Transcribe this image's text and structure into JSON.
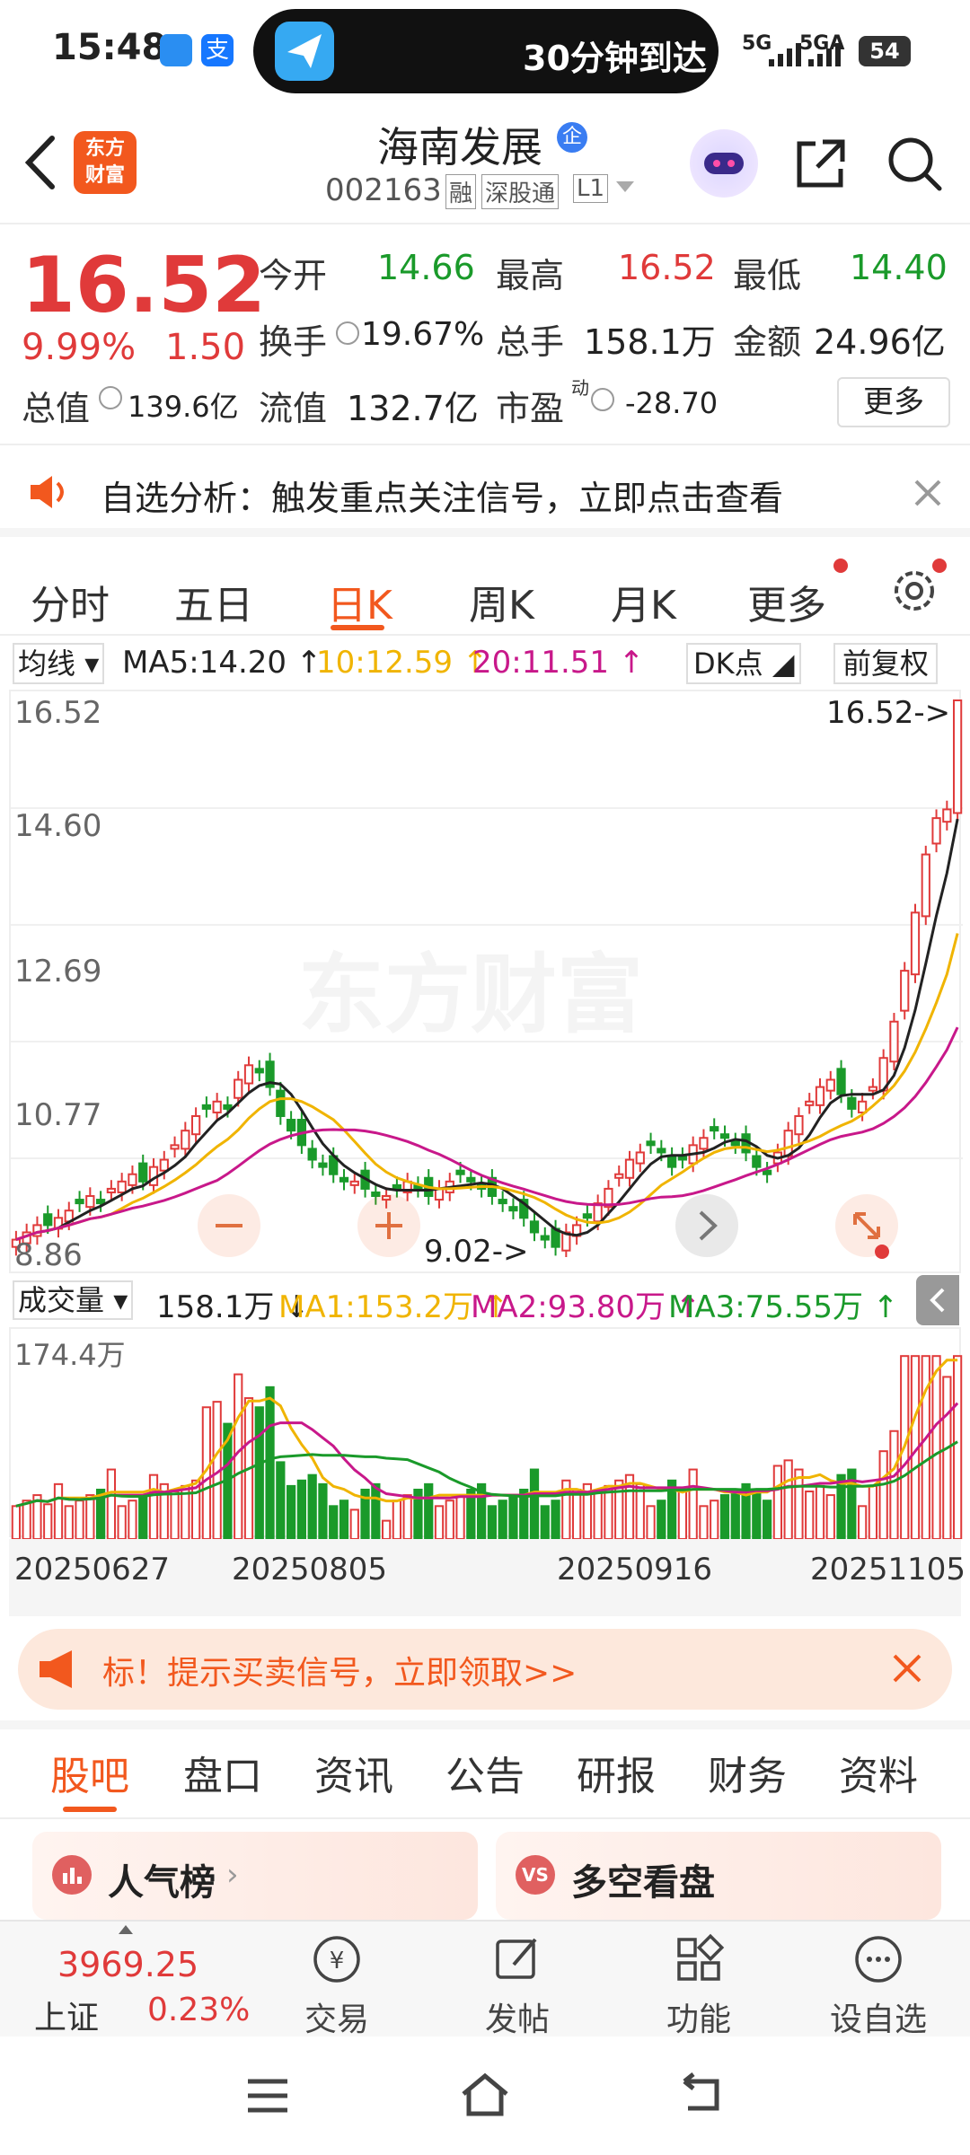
{
  "status": {
    "time": "15:48",
    "island_text": "30分钟到达",
    "signal1": "5G",
    "signal2": "5GA",
    "battery": "54"
  },
  "header": {
    "logo_text_line1": "东方",
    "logo_text_line2": "财富",
    "stock_name": "海南发展",
    "badge": "企",
    "stock_code": "002163",
    "tags": [
      "融",
      "深股通",
      "L1"
    ]
  },
  "quote": {
    "price": "16.52",
    "change_pct": "9.99%",
    "change": "1.50",
    "open_label": "今开",
    "open_value": "14.66",
    "high_label": "最高",
    "high_value": "16.52",
    "low_label": "最低",
    "low_value": "14.40",
    "turnover_label": "换手",
    "turnover_value": "19.67%",
    "volume_label": "总手",
    "volume_value": "158.1万",
    "amount_label": "金额",
    "amount_value": "24.96亿",
    "mktcap_label": "总值",
    "mktcap_value": "139.6亿",
    "float_label": "流值",
    "float_value": "132.7亿",
    "pe_label": "市盈",
    "pe_sup": "动",
    "pe_value": "-28.70",
    "more_button": "更多"
  },
  "notice": {
    "text": "自选分析：触发重点关注信号，立即点击查看"
  },
  "chart_tabs": [
    "分时",
    "五日",
    "日K",
    "周K",
    "月K",
    "更多"
  ],
  "chart_tab_active": "日K",
  "ma_bar": {
    "selector": "均线",
    "ma5": "MA5:14.20",
    "ma10": "10:12.59",
    "ma20": "20:11.51",
    "dk": "DK点",
    "fq": "前复权"
  },
  "price_axis": [
    "16.52",
    "14.60",
    "12.69",
    "10.77",
    "8.86"
  ],
  "annotations": {
    "high": "16.52->",
    "low": "9.02->"
  },
  "watermark": "东方财富",
  "vol_bar": {
    "selector": "成交量",
    "value": "158.1万",
    "ma1": "MA1:153.2万",
    "ma2": "MA2:93.80万",
    "ma3": "MA3:75.55万",
    "axis_top": "174.4万"
  },
  "date_axis": [
    "20250627",
    "20250805",
    "20250916",
    "20251105"
  ],
  "promo": {
    "text": "标！提示买卖信号，立即领取>>"
  },
  "section_tabs": [
    "股吧",
    "盘口",
    "资讯",
    "公告",
    "研报",
    "财务",
    "资料"
  ],
  "section_tab_active": "股吧",
  "cards": [
    "人气榜",
    "多空看盘"
  ],
  "bottom": {
    "index_value": "3969.25",
    "index_name": "上证",
    "index_change": "0.23%",
    "items": [
      "交易",
      "发帖",
      "功能",
      "设自选"
    ]
  },
  "colors": {
    "up": "#e03a3a",
    "down": "#1a9a2a",
    "accent": "#f2581e",
    "ma5": "#222222",
    "ma10": "#f0b400",
    "ma20": "#c8188a"
  },
  "chart_data": {
    "type": "candlestick",
    "x_start": "20250627",
    "x_end": "20251105",
    "ylim": [
      8.86,
      16.52
    ],
    "close": [
      9.1,
      9.2,
      9.3,
      9.3,
      9.4,
      9.5,
      9.6,
      9.7,
      9.6,
      9.8,
      9.9,
      10.0,
      9.9,
      10.1,
      10.2,
      10.4,
      10.6,
      10.8,
      10.9,
      11.0,
      10.9,
      11.3,
      11.5,
      11.4,
      11.2,
      10.8,
      10.6,
      10.4,
      10.2,
      10.1,
      10.0,
      9.9,
      9.9,
      9.8,
      9.7,
      9.7,
      9.8,
      9.9,
      9.8,
      9.7,
      9.8,
      9.9,
      10.0,
      9.9,
      9.8,
      9.7,
      9.6,
      9.5,
      9.4,
      9.2,
      9.1,
      9.0,
      9.2,
      9.3,
      9.4,
      9.6,
      9.8,
      10.0,
      10.2,
      10.3,
      10.4,
      10.3,
      10.1,
      10.2,
      10.4,
      10.5,
      10.6,
      10.5,
      10.4,
      10.3,
      10.1,
      10.0,
      10.3,
      10.6,
      10.8,
      11.0,
      11.2,
      11.3,
      11.1,
      10.9,
      11.0,
      11.2,
      11.6,
      12.1,
      12.8,
      13.6,
      14.4,
      14.9,
      15.02,
      16.52
    ],
    "volume_max": "174.4万"
  }
}
